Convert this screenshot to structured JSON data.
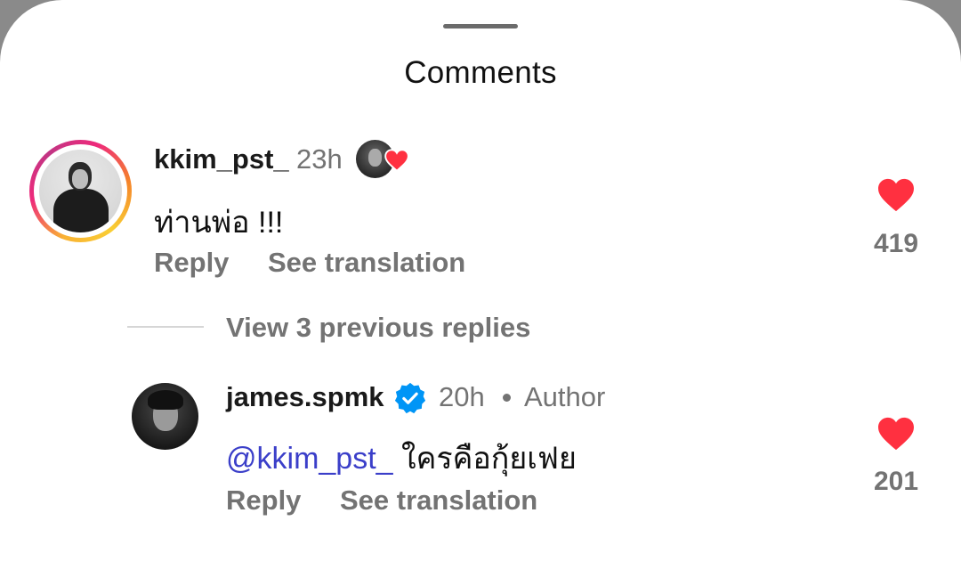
{
  "sheet": {
    "title": "Comments"
  },
  "comments": [
    {
      "username": "kkim_pst_",
      "time": "23h",
      "text": "ท่านพ่อ !!!",
      "reply_label": "Reply",
      "translate_label": "See translation",
      "likes": "419",
      "liked_by_author": true
    }
  ],
  "replies_toggle": {
    "label": "View 3 previous replies"
  },
  "replies": [
    {
      "username": "james.spmk",
      "verified": true,
      "time": "20h",
      "separator": "•",
      "role": "Author",
      "mention": "@kkim_pst_",
      "text": " ใครคือกุ้ยเฟย",
      "reply_label": "Reply",
      "translate_label": "See translation",
      "likes": "201"
    }
  ],
  "colors": {
    "like_red": "#ff3040",
    "verified_blue": "#0095f6",
    "mention_blue": "#3b3fc9",
    "muted_text": "#737373"
  },
  "icons": {
    "like": "heart-icon",
    "verified": "verified-badge-icon",
    "author_like": "small-heart-icon"
  }
}
